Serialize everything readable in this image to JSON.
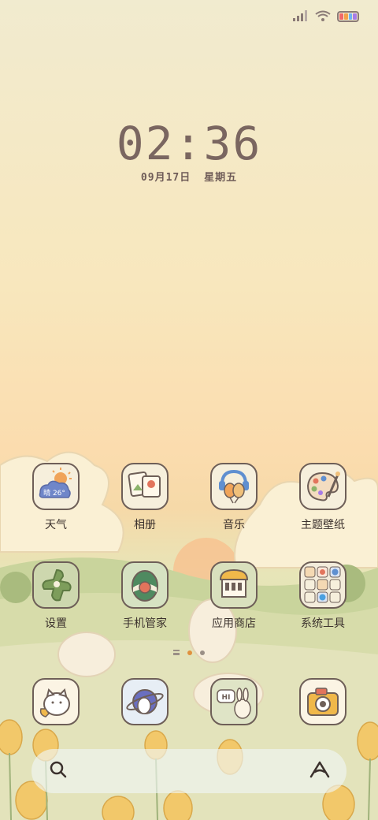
{
  "status_bar": {
    "signal_icon": "cellular-signal-icon",
    "wifi_icon": "wifi-icon",
    "battery_icon": "battery-icon",
    "battery_colors": [
      "#f06a6a",
      "#f2a24a",
      "#6fb3f2",
      "#a77be6"
    ]
  },
  "clock": {
    "time": "02:36",
    "date_month_day": "09月17日",
    "weekday": "星期五"
  },
  "apps": [
    {
      "label": "天气",
      "icon": "weather-icon",
      "weather_text": "晴 26°"
    },
    {
      "label": "相册",
      "icon": "gallery-icon"
    },
    {
      "label": "音乐",
      "icon": "music-icon"
    },
    {
      "label": "主题壁纸",
      "icon": "theme-wallpaper-icon"
    },
    {
      "label": "设置",
      "icon": "settings-icon"
    },
    {
      "label": "手机管家",
      "icon": "phone-manager-icon"
    },
    {
      "label": "应用商店",
      "icon": "app-store-icon"
    },
    {
      "label": "系统工具",
      "icon": "system-tools-folder-icon"
    }
  ],
  "dock": [
    {
      "icon": "phone-icon"
    },
    {
      "icon": "browser-icon"
    },
    {
      "icon": "messages-icon",
      "bubble_text": "HI"
    },
    {
      "icon": "camera-icon"
    }
  ],
  "page_indicator": {
    "pages": 2,
    "current": 0,
    "active_color": "#e0913e",
    "inactive_color": "#9a8f86"
  },
  "search_bar": {
    "search_icon": "search-icon",
    "assistant_icon": "assistant-a-icon"
  }
}
